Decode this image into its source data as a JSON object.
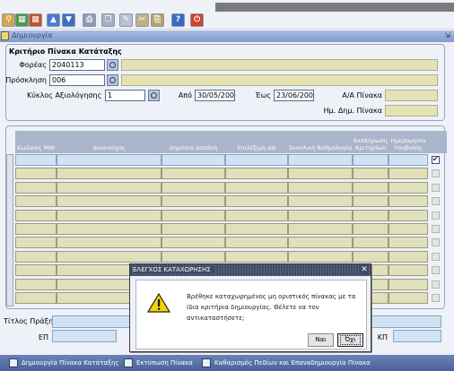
{
  "toolbar": {
    "buttons": [
      {
        "icon": "search-form-icon",
        "color": "#d4a64a",
        "glyph": "⚲"
      },
      {
        "icon": "grid-view-icon",
        "color": "#4b9b4b",
        "glyph": "▦"
      },
      {
        "icon": "table-icon",
        "color": "#c8502c",
        "glyph": "▦"
      },
      {
        "icon": "arrow-up-icon",
        "color": "#4a7bd0",
        "glyph": "▲"
      },
      {
        "icon": "arrow-down-icon",
        "color": "#3d6ec4",
        "glyph": "▼"
      },
      {
        "icon": "print-icon",
        "color": "#8f9bb3",
        "glyph": "⎙"
      },
      {
        "icon": "copy-icon",
        "color": "#a5afc2",
        "glyph": "❐"
      },
      {
        "icon": "edit-icon",
        "color": "#b8c1d3",
        "glyph": "✎"
      },
      {
        "icon": "cut-icon",
        "color": "#c0b08a",
        "glyph": "✂"
      },
      {
        "icon": "paste-icon",
        "color": "#b9a36a",
        "glyph": "⎘"
      },
      {
        "icon": "help-icon",
        "color": "#3c69c9",
        "glyph": "?"
      },
      {
        "icon": "exit-icon",
        "color": "#d5402b",
        "glyph": "⏻"
      }
    ]
  },
  "window": {
    "title": "Δημιουργία",
    "resize_glyph": "⇲"
  },
  "criteria": {
    "title": "Κριτήριο Πίνακα Κατάταξης",
    "foreas_label": "Φορέας",
    "foreas_value": "2040113",
    "prosklisi_label": "Πρόσκληση",
    "prosklisi_value": "006",
    "kyklos_label": "Κύκλος Αξιολόγησης",
    "kyklos_value": "1",
    "apo_label": "Από",
    "apo_value": "30/05/2009",
    "eos_label": "Έως",
    "eos_value": "23/06/2009",
    "aa_label": "Α/Α Πίνακα",
    "date_label": "Ημ. Δημ. Πίνακα"
  },
  "grid": {
    "columns": [
      "Κωδικός ΜΙΘ",
      "Δικαιούχος",
      "Δημόσια Δαπάνη",
      "Επιλέξιμη ΔΔ",
      "Συνολική Βαθμολογία",
      "Εκπλήρωση Κριτηρίων",
      "Ημερομηνία Υποβολής"
    ],
    "row_count": 11,
    "first_row_checked": true
  },
  "bottom": {
    "titlos_label": "Τίτλος Πράξης",
    "ep_label": "ΕΠ",
    "kp_label": "ΚΠ"
  },
  "footer": {
    "create_label": "Δημιουργία Πίνακα Κατάταξης",
    "print_label": "Εκτύπωση Πίνακα",
    "clear_label": "Καθαρισμός Πεδίων και Επαναδημιουργία Πίνακα"
  },
  "dialog": {
    "title": "ΕΛΕΓΧΟΣ ΚΑΤΑΧΩΡΗΣΗΣ",
    "close_glyph": "✕",
    "message": "Βρέθηκε καταχωρημένος μη οριστικός πίνακας με τα ίδια κριτήρια δημιουργίας. Θέλετε να τον αντικαταστήσετε;",
    "yes_label": "Ναι",
    "no_label": "Όχι"
  }
}
